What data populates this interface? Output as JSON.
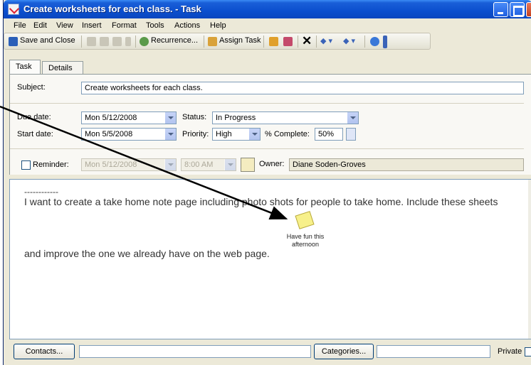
{
  "window": {
    "title": "Create worksheets for each class. - Task"
  },
  "menu": {
    "items": [
      "File",
      "Edit",
      "View",
      "Insert",
      "Format",
      "Tools",
      "Actions",
      "Help"
    ]
  },
  "toolbar": {
    "save_close": "Save and Close",
    "recurrence": "Recurrence...",
    "assign_task": "Assign Task"
  },
  "tabs": [
    {
      "label": "Task",
      "selected": true
    },
    {
      "label": "Details",
      "selected": false
    }
  ],
  "form": {
    "subject_label": "Subject:",
    "subject_value": "Create worksheets for each class.",
    "due_label": "Due date:",
    "due_value": "Mon 5/12/2008",
    "start_label": "Start date:",
    "start_value": "Mon 5/5/2008",
    "status_label": "Status:",
    "status_value": "In Progress",
    "priority_label": "Priority:",
    "priority_value": "High",
    "complete_label": "% Complete:",
    "complete_value": "50%",
    "reminder_label": "Reminder:",
    "reminder_checked": false,
    "reminder_date": "Mon 5/12/2008",
    "reminder_time": "8:00 AM",
    "owner_label": "Owner:",
    "owner_value": "Diane Soden-Groves"
  },
  "body": {
    "dashes": "------------",
    "line1": "I want to create a take home note page including photo shots for people to take home. Include these sheets",
    "line2": "and improve the one we already have on the web page.",
    "note_caption_1": "Have fun this",
    "note_caption_2": "afternoon"
  },
  "footer": {
    "contacts_label": "Contacts...",
    "categories_label": "Categories...",
    "private_label": "Private"
  },
  "colors": {
    "titlebar": "#0b4fce",
    "window_bg": "#ece9d8",
    "arrow": "#000000",
    "note": "#f7f08a"
  }
}
